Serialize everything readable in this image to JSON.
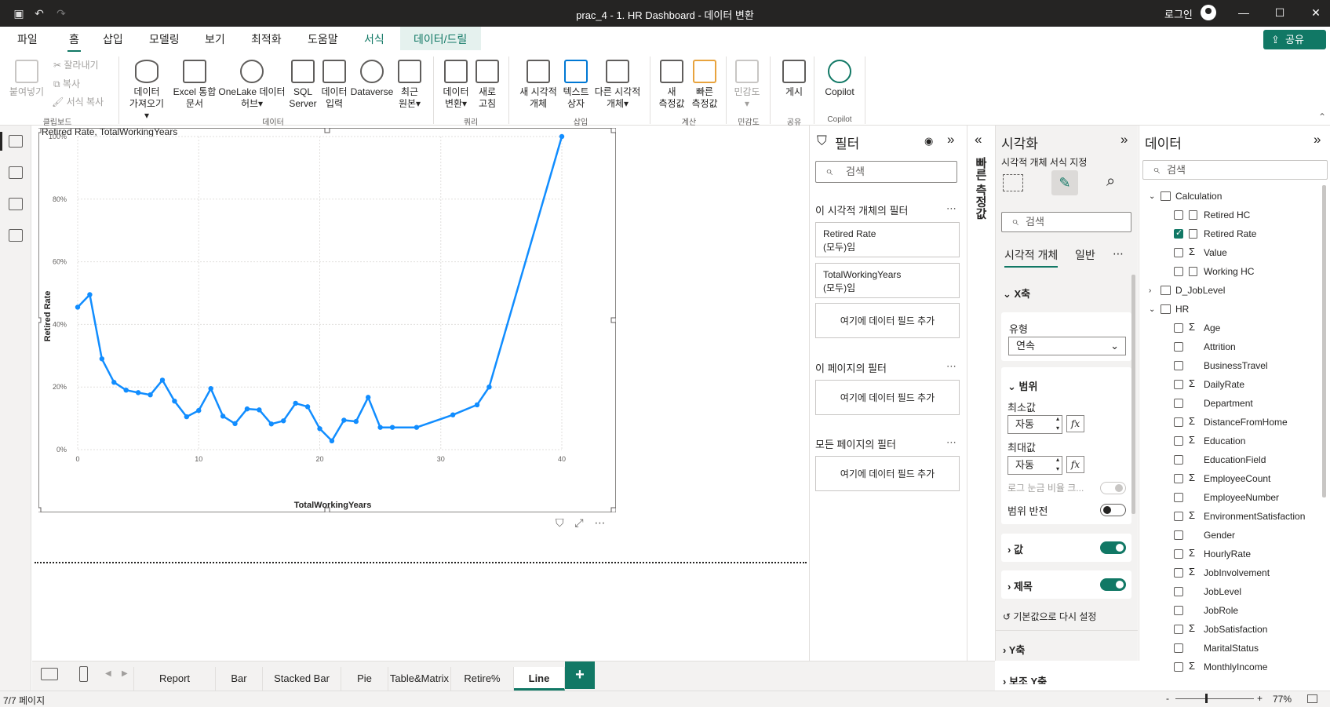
{
  "titlebar": {
    "title": "prac_4 - 1. HR Dashboard - 데이터 변환",
    "login": "로그인",
    "minimize": "—",
    "maximize": "☐",
    "close": "✕"
  },
  "menu": {
    "tabs": [
      "파일",
      "홈",
      "삽입",
      "모델링",
      "보기",
      "최적화",
      "도움말",
      "서식",
      "데이터/드릴"
    ],
    "active": "홈",
    "share": "공유"
  },
  "ribbon": {
    "clipboard": {
      "paste": "붙여넣기",
      "cut": "잘라내기",
      "copy": "복사",
      "format_painter": "서식 복사",
      "group": "클립보드"
    },
    "data": {
      "get_data": [
        "데이터",
        "가져오기"
      ],
      "excel": [
        "Excel 통합",
        "문서"
      ],
      "onelake": [
        "OneLake 데이터",
        "허브"
      ],
      "sql": [
        "SQL",
        "Server"
      ],
      "enter_data": [
        "데이터",
        "입력"
      ],
      "dataverse": "Dataverse",
      "recent": [
        "최근",
        "원본"
      ],
      "group": "데이터"
    },
    "query": {
      "transform": [
        "데이터",
        "변환"
      ],
      "refresh": [
        "새로",
        "고침"
      ],
      "group": "쿼리"
    },
    "insert": {
      "new_visual": [
        "새 시각적",
        "개체"
      ],
      "textbox": [
        "텍스트",
        "상자"
      ],
      "more_visuals": [
        "다른 시각적",
        "개체"
      ],
      "group": "삽입"
    },
    "calc": {
      "new_measure": [
        "새",
        "측정값"
      ],
      "quick_measure": [
        "빠른",
        "측정값"
      ],
      "group": "계산"
    },
    "sensitivity": {
      "label": "민감도",
      "group": "민감도"
    },
    "share": {
      "publish": "게시",
      "group": "공유"
    },
    "copilot": {
      "label": "Copilot",
      "group": "Copilot"
    }
  },
  "chart_data": {
    "type": "line",
    "title": "Retired Rate, TotalWorkingYears",
    "xlabel": "TotalWorkingYears",
    "ylabel": "Retired Rate",
    "xlim": [
      0,
      40
    ],
    "ylim": [
      0,
      100
    ],
    "xticks": [
      "0",
      "10",
      "20",
      "30",
      "40"
    ],
    "yticks": [
      "0%",
      "20%",
      "40%",
      "60%",
      "80%",
      "100%"
    ],
    "grid": true,
    "color": "#118DFF",
    "x": [
      0,
      1,
      2,
      3,
      4,
      5,
      6,
      7,
      8,
      9,
      10,
      11,
      12,
      13,
      14,
      15,
      16,
      17,
      18,
      19,
      20,
      21,
      22,
      23,
      24,
      25,
      26,
      28,
      31,
      33,
      34,
      40
    ],
    "y": [
      45.5,
      49.5,
      29,
      21.5,
      19,
      18.2,
      17.5,
      22.2,
      15.5,
      10.5,
      12.5,
      19.5,
      10.7,
      8.3,
      13,
      12.7,
      8.2,
      9.2,
      14.8,
      13.7,
      6.7,
      2.8,
      9.4,
      9,
      16.7,
      7.1,
      7.1,
      7.1,
      11.1,
      14.3,
      20,
      100
    ]
  },
  "visual_tools": {
    "filter": "⛉",
    "focus": "⤢",
    "more": "⋯"
  },
  "filters": {
    "title": "필터",
    "search_placeholder": "검색",
    "visual_section": "이 시각적 개체의 필터",
    "page_section": "이 페이지의 필터",
    "all_section": "모든 페이지의 필터",
    "cards": [
      {
        "field": "Retired Rate",
        "state": "(모두)임"
      },
      {
        "field": "TotalWorkingYears",
        "state": "(모두)임"
      }
    ],
    "add_field": "여기에 데이터 필드 추가",
    "more": "⋯",
    "collapse": "»",
    "eye": "◉"
  },
  "quick_measure": {
    "label": "빠른 측정값",
    "collapse": "«"
  },
  "visualizations": {
    "title": "시각화",
    "collapse": "»",
    "subtitle": "시각적 개체 서식 지정",
    "search_placeholder": "검색",
    "tabs": [
      "시각적 개체",
      "일반"
    ],
    "more": "⋯",
    "x_axis": "X축",
    "type_label": "유형",
    "type_value": "연속",
    "range": "범위",
    "min_label": "최소값",
    "max_label": "최대값",
    "auto": "자동",
    "fx": "fx",
    "log_scale": "로그 눈금 비율 크...",
    "invert_range": "범위 반전",
    "values": "값",
    "title_section": "제목",
    "reset": "기본값으로 다시 설정",
    "y_axis": "Y축",
    "secondary_y": "보조 Y축"
  },
  "data_pane": {
    "title": "데이터",
    "collapse": "»",
    "search_placeholder": "검색",
    "tables": [
      {
        "name": "Calculation",
        "fields": [
          {
            "name": "Retired HC",
            "kind": "calc",
            "checked": false
          },
          {
            "name": "Retired Rate",
            "kind": "calc",
            "checked": true
          },
          {
            "name": "Value",
            "kind": "sum",
            "checked": false
          },
          {
            "name": "Working HC",
            "kind": "calc",
            "checked": false
          }
        ]
      },
      {
        "name": "D_JobLevel",
        "fields": []
      },
      {
        "name": "HR",
        "fields": [
          {
            "name": "Age",
            "kind": "sum"
          },
          {
            "name": "Attrition",
            "kind": "text"
          },
          {
            "name": "BusinessTravel",
            "kind": "text"
          },
          {
            "name": "DailyRate",
            "kind": "sum"
          },
          {
            "name": "Department",
            "kind": "text"
          },
          {
            "name": "DistanceFromHome",
            "kind": "sum"
          },
          {
            "name": "Education",
            "kind": "sum"
          },
          {
            "name": "EducationField",
            "kind": "text"
          },
          {
            "name": "EmployeeCount",
            "kind": "sum"
          },
          {
            "name": "EmployeeNumber",
            "kind": "text"
          },
          {
            "name": "EnvironmentSatisfaction",
            "kind": "sum"
          },
          {
            "name": "Gender",
            "kind": "text"
          },
          {
            "name": "HourlyRate",
            "kind": "sum"
          },
          {
            "name": "JobInvolvement",
            "kind": "sum"
          },
          {
            "name": "JobLevel",
            "kind": "text"
          },
          {
            "name": "JobRole",
            "kind": "text"
          },
          {
            "name": "JobSatisfaction",
            "kind": "sum"
          },
          {
            "name": "MaritalStatus",
            "kind": "text"
          },
          {
            "name": "MonthlyIncome",
            "kind": "sum"
          }
        ]
      }
    ]
  },
  "page_tabs": {
    "tabs": [
      "Report",
      "Bar",
      "Stacked Bar",
      "Pie",
      "Table&Matrix",
      "Retire%",
      "Line"
    ],
    "active": "Line",
    "add": "+"
  },
  "status": {
    "pages": "7/7 페이지",
    "zoom": "77%",
    "minus": "-",
    "plus": "+"
  }
}
